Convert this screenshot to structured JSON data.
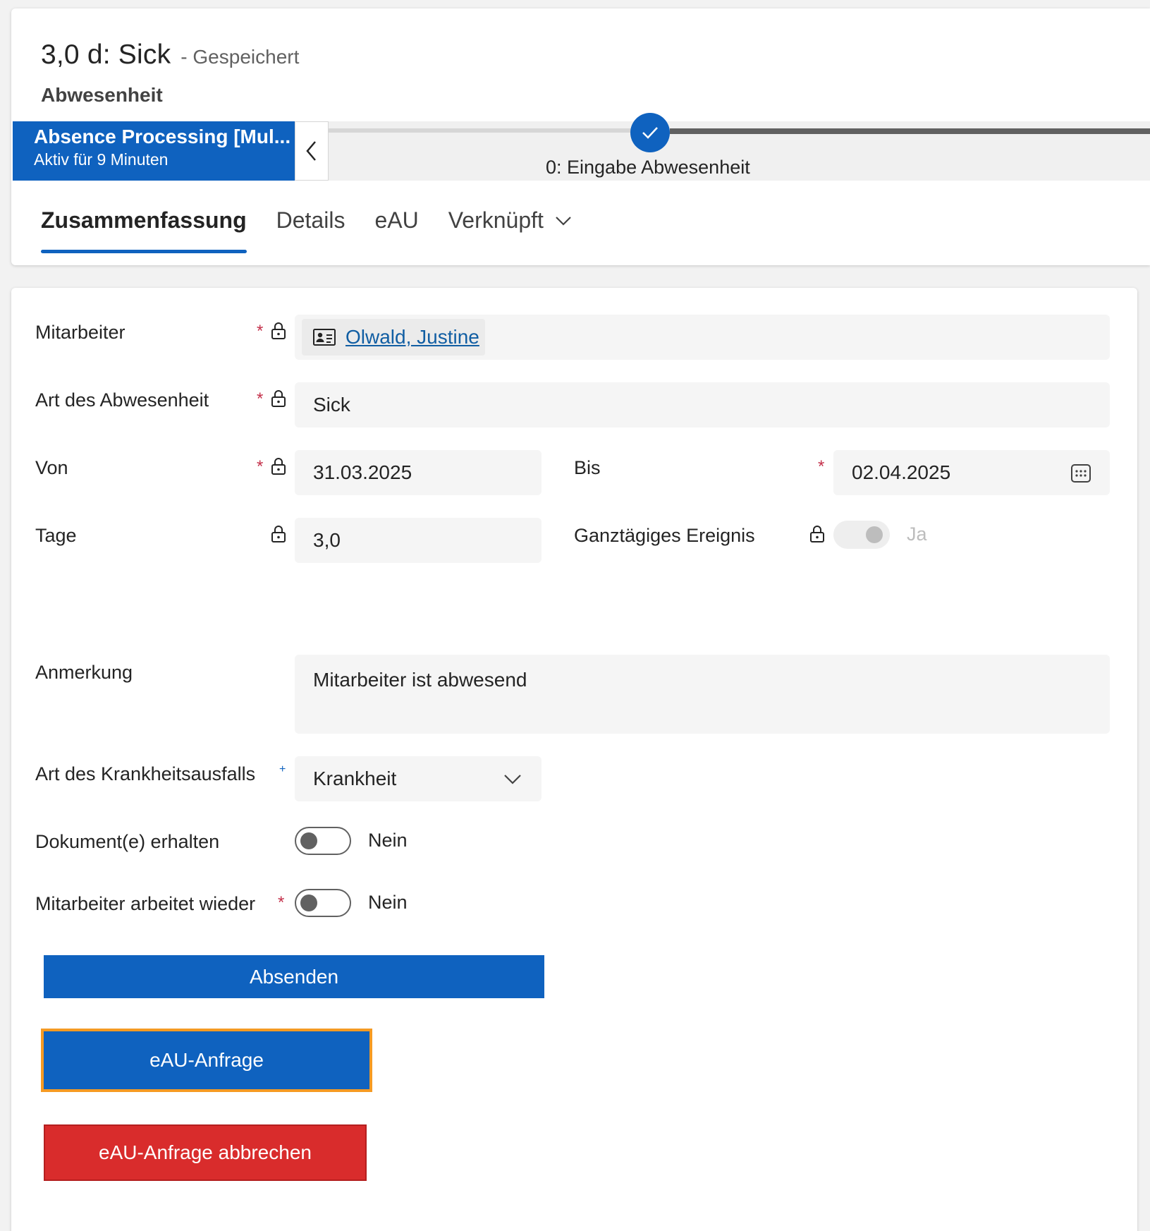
{
  "header": {
    "title": "3,0 d: Sick",
    "saved_status": "- Gespeichert",
    "entity": "Abwesenheit"
  },
  "process": {
    "name": "Absence Processing [Mul...",
    "active_duration": "Aktiv für 9 Minuten",
    "stage_label": "0: Eingabe Abwesenheit"
  },
  "tabs": [
    {
      "label": "Zusammenfassung"
    },
    {
      "label": "Details"
    },
    {
      "label": "eAU"
    },
    {
      "label": "Verknüpft"
    }
  ],
  "form": {
    "employee": {
      "label": "Mitarbeiter",
      "value": "Olwald, Justine"
    },
    "absence_type": {
      "label": "Art des Abwesenheit",
      "value": "Sick"
    },
    "from": {
      "label": "Von",
      "value": "31.03.2025"
    },
    "to": {
      "label": "Bis",
      "value": "02.04.2025"
    },
    "days": {
      "label": "Tage",
      "value": "3,0"
    },
    "all_day": {
      "label": "Ganztägiges Ereignis",
      "value": "Ja"
    },
    "note": {
      "label": "Anmerkung",
      "value": "Mitarbeiter ist abwesend"
    },
    "illness_type": {
      "label": "Art des Krankheitsausfalls",
      "value": "Krankheit"
    },
    "documents_received": {
      "label": "Dokument(e) erhalten",
      "value": "Nein"
    },
    "back_to_work": {
      "label": "Mitarbeiter arbeitet wieder",
      "value": "Nein"
    }
  },
  "buttons": {
    "submit": "Absenden",
    "eau_request": "eAU-Anfrage",
    "eau_cancel": "eAU-Anfrage abbrechen"
  },
  "colors": {
    "accent": "#0f62bf",
    "danger": "#d92c2c",
    "focus": "#f59a23",
    "required": "#c4314b"
  },
  "icons": {
    "lock": "lock-icon",
    "contact_card": "contact-card-icon",
    "calendar": "calendar-icon",
    "chevron_down": "chevron-down-icon",
    "chevron_left": "chevron-left-icon",
    "checkmark": "checkmark-icon"
  }
}
